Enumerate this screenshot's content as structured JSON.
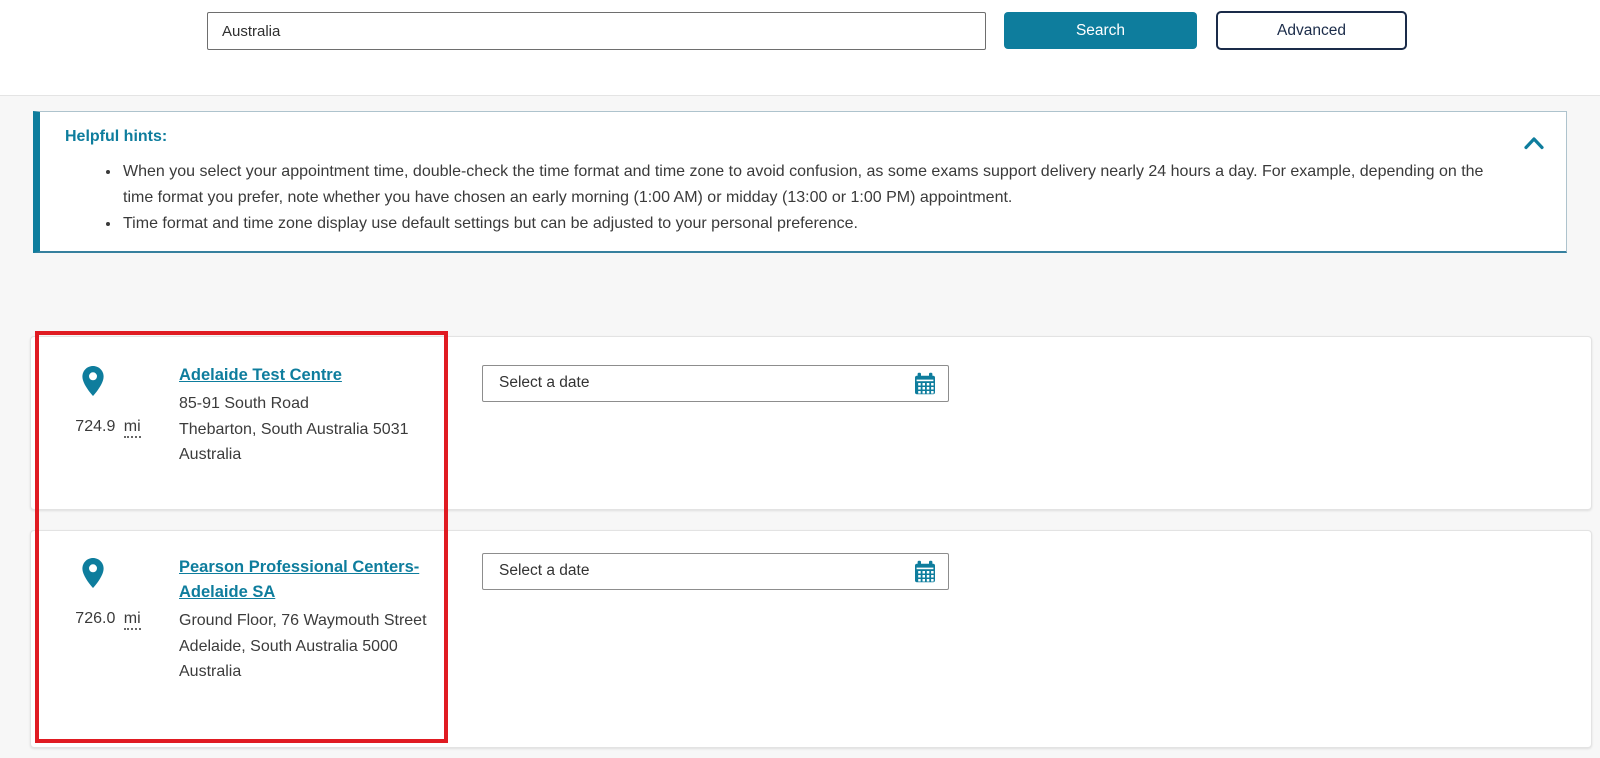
{
  "search": {
    "input_value": "Australia",
    "search_label": "Search",
    "advanced_label": "Advanced"
  },
  "hints": {
    "title": "Helpful hints:",
    "items": [
      "When you select your appointment time, double-check the time format and time zone to avoid confusion, as some exams support delivery nearly 24 hours a day. For example, depending on the time format you prefer, note whether you have chosen an early morning (1:00 AM) or midday (13:00 or 1:00 PM) appointment.",
      "Time format and time zone display use default settings but can be adjusted to your personal preference."
    ]
  },
  "results": [
    {
      "distance_value": "724.9",
      "distance_unit": "mi",
      "name": "Adelaide Test Centre",
      "address_lines": [
        "85-91 South Road",
        "Thebarton, South Australia 5031",
        "Australia"
      ],
      "date_placeholder": "Select a date"
    },
    {
      "distance_value": "726.0",
      "distance_unit": "mi",
      "name": "Pearson Professional Centers-Adelaide SA",
      "address_lines": [
        "Ground Floor, 76 Waymouth Street",
        "Adelaide, South Australia 5000",
        "Australia"
      ],
      "date_placeholder": "Select a date"
    }
  ],
  "icons": {
    "location_pin": "location-pin-icon",
    "calendar": "calendar-icon",
    "collapse": "chevron-up-icon"
  },
  "colors": {
    "accent_teal": "#0E7D9D",
    "navy": "#1A2B49",
    "annotation_red": "#E01B22",
    "section_bg": "#F7F7F7"
  },
  "annotation": {
    "type": "highlight-rectangle",
    "color": "#E01B22"
  }
}
